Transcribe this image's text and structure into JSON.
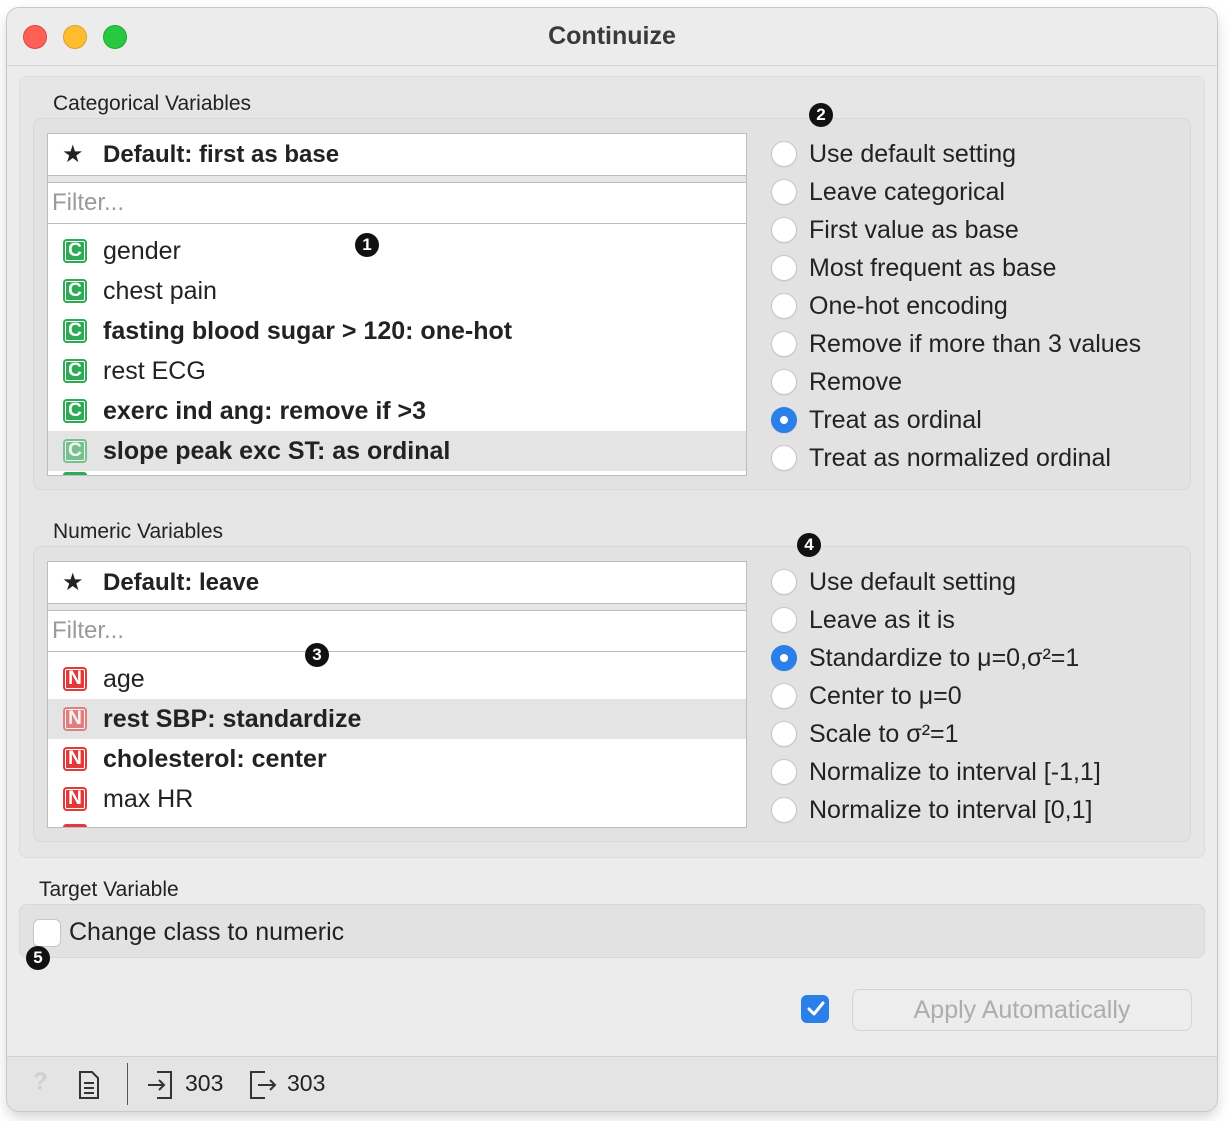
{
  "window": {
    "title": "Continuize"
  },
  "categorical": {
    "label": "Categorical Variables",
    "default": "Default: first as base",
    "filter_placeholder": "Filter...",
    "variables": [
      {
        "badge": "C",
        "name": "gender",
        "bold": false,
        "selected": false
      },
      {
        "badge": "C",
        "name": "chest pain",
        "bold": false,
        "selected": false
      },
      {
        "badge": "C",
        "name": "fasting blood sugar > 120: one-hot",
        "bold": true,
        "selected": false
      },
      {
        "badge": "C",
        "name": "rest ECG",
        "bold": false,
        "selected": false
      },
      {
        "badge": "C",
        "name": "exerc ind ang: remove if >3",
        "bold": true,
        "selected": false
      },
      {
        "badge": "C",
        "name": "slope peak exc ST: as ordinal",
        "bold": true,
        "selected": true
      }
    ],
    "options": [
      {
        "label": "Use default setting",
        "checked": false
      },
      {
        "label": "Leave categorical",
        "checked": false
      },
      {
        "label": "First value as base",
        "checked": false
      },
      {
        "label": "Most frequent as base",
        "checked": false
      },
      {
        "label": "One-hot encoding",
        "checked": false
      },
      {
        "label": "Remove if more than 3 values",
        "checked": false
      },
      {
        "label": "Remove",
        "checked": false
      },
      {
        "label": "Treat as ordinal",
        "checked": true
      },
      {
        "label": "Treat as normalized ordinal",
        "checked": false
      }
    ]
  },
  "numeric": {
    "label": "Numeric Variables",
    "default": "Default: leave",
    "filter_placeholder": "Filter...",
    "variables": [
      {
        "badge": "N",
        "name": "age",
        "bold": false,
        "selected": false
      },
      {
        "badge": "N",
        "name": "rest SBP: standardize",
        "bold": true,
        "selected": true
      },
      {
        "badge": "N",
        "name": "cholesterol: center",
        "bold": true,
        "selected": false
      },
      {
        "badge": "N",
        "name": "max HR",
        "bold": false,
        "selected": false
      }
    ],
    "options": [
      {
        "label": "Use default setting",
        "checked": false
      },
      {
        "label": "Leave as it is",
        "checked": false
      },
      {
        "label": "Standardize to μ=0,σ²=1",
        "checked": true
      },
      {
        "label": "Center to μ=0",
        "checked": false
      },
      {
        "label": "Scale to σ²=1",
        "checked": false
      },
      {
        "label": "Normalize to interval [-1,1]",
        "checked": false
      },
      {
        "label": "Normalize to interval [0,1]",
        "checked": false
      }
    ]
  },
  "target": {
    "label": "Target Variable",
    "checkbox_label": "Change class to numeric",
    "checked": false
  },
  "apply": {
    "auto_checked": true,
    "label": "Apply Automatically"
  },
  "markers": [
    "1",
    "2",
    "3",
    "4",
    "5"
  ],
  "status": {
    "input_count": "303",
    "output_count": "303",
    "help_icon": "?"
  },
  "colors": {
    "accent": "#2a7fe8",
    "categorical_badge": "#2faa56",
    "numeric_badge": "#e23a3a"
  }
}
